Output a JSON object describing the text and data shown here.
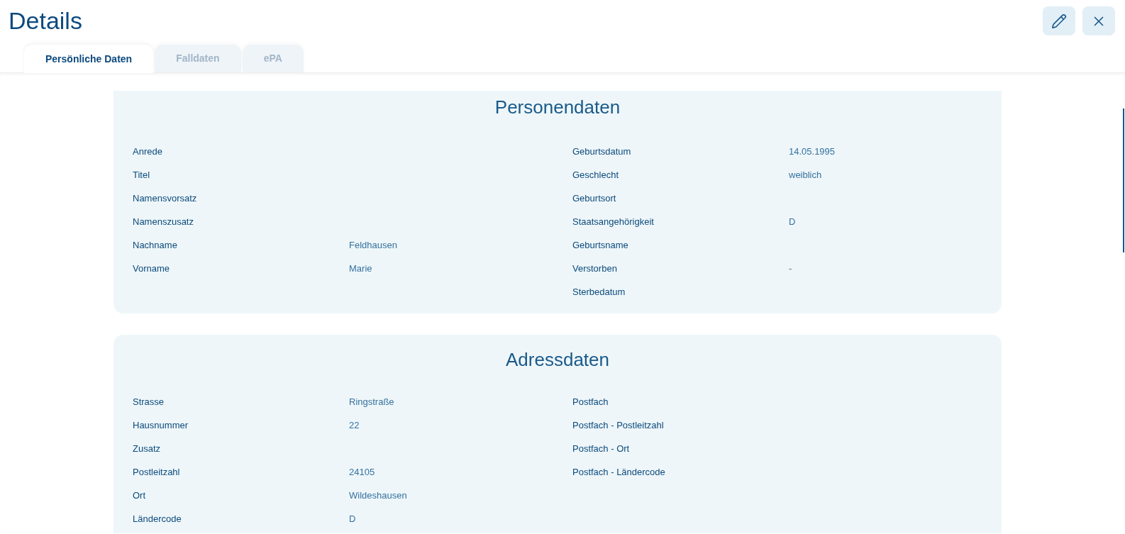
{
  "header": {
    "title": "Details",
    "buttons": [
      {
        "kind": "edit"
      },
      {
        "kind": "close"
      }
    ]
  },
  "tabs": [
    {
      "label": "Persönliche Daten",
      "selected": true
    },
    {
      "label": "Falldaten",
      "selected": false
    },
    {
      "label": "ePA",
      "selected": false
    }
  ],
  "sections": [
    {
      "title": "Personendaten",
      "left": [
        {
          "label": "Anrede"
        },
        {
          "label": "Titel"
        },
        {
          "label": "Namensvorsatz"
        },
        {
          "label": "Namenszusatz"
        },
        {
          "label": "Nachname",
          "value": "Feldhausen"
        },
        {
          "label": "Vorname",
          "value": "Marie"
        }
      ],
      "right": [
        {
          "label": "Geburtsdatum",
          "value": "14.05.1995"
        },
        {
          "label": "Geschlecht",
          "value": "weiblich"
        },
        {
          "label": "Geburtsort"
        },
        {
          "label": "Staatsangehörigkeit",
          "value": "D"
        },
        {
          "label": "Geburtsname"
        },
        {
          "label": "Verstorben",
          "value": "-"
        },
        {
          "label": "Sterbedatum"
        }
      ]
    },
    {
      "title": "Adressdaten",
      "left": [
        {
          "label": "Strasse",
          "value": "Ringstraße"
        },
        {
          "label": "Hausnummer",
          "value": "22"
        },
        {
          "label": "Zusatz"
        },
        {
          "label": "Postleitzahl",
          "value": "24105"
        },
        {
          "label": "Ort",
          "value": "Wildeshausen"
        },
        {
          "label": "Ländercode",
          "value": "D"
        }
      ],
      "right": [
        {
          "label": "Postfach"
        },
        {
          "label": "Postfach - Postleitzahl"
        },
        {
          "label": "Postfach - Ort"
        },
        {
          "label": "Postfach - Ländercode"
        }
      ]
    }
  ]
}
